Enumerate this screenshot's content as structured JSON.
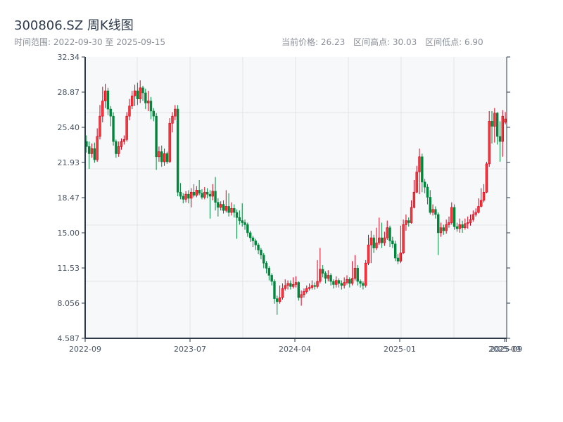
{
  "header": {
    "title": "300806.SZ 周K线图",
    "range_label": "时间范围: 2022-09-30 至 2025-09-15",
    "current_price": "当前价格: 26.23",
    "range_high": "区间高点: 30.03",
    "range_low": "区间低点: 6.90"
  },
  "chart_data": {
    "type": "candlestick",
    "title": "300806.SZ 周K线图",
    "ylim": [
      4.587,
      32.34
    ],
    "y_ticks": [
      "32.34",
      "28.87",
      "25.40",
      "21.93",
      "18.47",
      "15.00",
      "11.53",
      "8.056",
      "4.587"
    ],
    "x_ticks": [
      {
        "label": "2022-09",
        "index": 0
      },
      {
        "label": "2023-07",
        "index": 39
      },
      {
        "label": "2024-04",
        "index": 78
      },
      {
        "label": "2025-01",
        "index": 117
      },
      {
        "label": "2025-09",
        "index": 156
      },
      {
        "label": "2025-09",
        "index": 156.6
      }
    ],
    "grid": true,
    "colors": {
      "up": "#d9001b",
      "down": "#00873c",
      "axis": "#2d3a4a",
      "grid": "#e1e4ea",
      "background": "#f6f8fa"
    },
    "ohlc_fields": [
      "open",
      "high",
      "low",
      "close"
    ],
    "candles": [
      [
        24.0,
        24.6,
        22.9,
        23.5
      ],
      [
        23.5,
        24.0,
        21.3,
        22.8
      ],
      [
        22.8,
        23.8,
        22.4,
        23.3
      ],
      [
        23.3,
        23.9,
        21.9,
        22.2
      ],
      [
        22.2,
        25.3,
        22.0,
        24.5
      ],
      [
        24.5,
        27.6,
        24.2,
        26.5
      ],
      [
        26.5,
        29.4,
        25.9,
        28.0
      ],
      [
        28.0,
        29.7,
        27.3,
        29.0
      ],
      [
        29.0,
        29.3,
        26.6,
        27.2
      ],
      [
        27.2,
        27.5,
        25.5,
        26.5
      ],
      [
        26.5,
        26.9,
        23.6,
        24.0
      ],
      [
        24.0,
        24.2,
        22.4,
        22.8
      ],
      [
        22.8,
        24.0,
        22.5,
        23.5
      ],
      [
        23.5,
        24.3,
        23.2,
        24.0
      ],
      [
        24.0,
        24.6,
        23.7,
        24.2
      ],
      [
        24.2,
        26.9,
        24.0,
        26.5
      ],
      [
        26.5,
        28.2,
        26.1,
        27.5
      ],
      [
        27.5,
        29.0,
        27.2,
        28.5
      ],
      [
        28.5,
        29.6,
        27.5,
        29.0
      ],
      [
        29.0,
        29.8,
        27.6,
        28.2
      ],
      [
        28.2,
        30.03,
        27.8,
        29.3
      ],
      [
        29.3,
        29.5,
        28.0,
        28.8
      ],
      [
        28.8,
        29.2,
        27.2,
        27.8
      ],
      [
        27.8,
        29.0,
        27.0,
        28.0
      ],
      [
        28.0,
        28.4,
        26.2,
        27.0
      ],
      [
        27.0,
        27.3,
        26.0,
        26.5
      ],
      [
        26.5,
        26.8,
        21.2,
        22.5
      ],
      [
        22.5,
        23.5,
        22.0,
        23.0
      ],
      [
        23.0,
        23.6,
        21.5,
        22.0
      ],
      [
        22.0,
        23.3,
        21.6,
        22.8
      ],
      [
        22.8,
        23.0,
        21.8,
        22.0
      ],
      [
        22.0,
        26.3,
        21.9,
        25.8
      ],
      [
        25.8,
        26.9,
        24.9,
        26.5
      ],
      [
        26.5,
        27.6,
        26.1,
        27.2
      ],
      [
        27.2,
        27.6,
        18.6,
        19.0
      ],
      [
        19.0,
        19.9,
        18.3,
        18.6
      ],
      [
        18.6,
        18.9,
        17.9,
        18.3
      ],
      [
        18.3,
        19.1,
        18.0,
        18.8
      ],
      [
        18.8,
        19.2,
        17.9,
        18.4
      ],
      [
        18.4,
        19.4,
        17.5,
        19.0
      ],
      [
        19.0,
        19.8,
        18.5,
        18.7
      ],
      [
        18.7,
        19.6,
        18.5,
        19.2
      ],
      [
        19.2,
        20.2,
        18.7,
        18.9
      ],
      [
        18.9,
        19.3,
        18.3,
        18.5
      ],
      [
        18.5,
        19.5,
        18.3,
        19.0
      ],
      [
        19.0,
        19.4,
        18.4,
        18.8
      ],
      [
        18.8,
        19.2,
        16.4,
        18.6
      ],
      [
        18.6,
        19.8,
        18.2,
        19.1
      ],
      [
        19.1,
        20.5,
        17.2,
        18.0
      ],
      [
        18.0,
        18.4,
        16.6,
        17.5
      ],
      [
        17.5,
        18.1,
        17.2,
        17.8
      ],
      [
        17.8,
        18.2,
        16.9,
        17.2
      ],
      [
        17.2,
        19.2,
        17.0,
        17.6
      ],
      [
        17.6,
        18.9,
        16.6,
        17.0
      ],
      [
        17.0,
        18.0,
        16.7,
        17.4
      ],
      [
        17.4,
        17.8,
        16.5,
        17.0
      ],
      [
        17.0,
        17.3,
        14.4,
        16.5
      ],
      [
        16.5,
        17.2,
        15.8,
        16.2
      ],
      [
        16.2,
        17.9,
        15.6,
        16.0
      ],
      [
        16.0,
        16.3,
        15.3,
        15.8
      ],
      [
        15.8,
        16.0,
        14.6,
        15.0
      ],
      [
        15.0,
        15.2,
        14.1,
        14.5
      ],
      [
        14.5,
        14.7,
        13.6,
        14.2
      ],
      [
        14.2,
        14.4,
        13.3,
        13.8
      ],
      [
        13.8,
        14.0,
        12.9,
        13.3
      ],
      [
        13.3,
        13.5,
        12.4,
        12.8
      ],
      [
        12.8,
        13.0,
        11.5,
        12.0
      ],
      [
        12.0,
        12.2,
        11.0,
        11.5
      ],
      [
        11.5,
        11.7,
        10.3,
        10.8
      ],
      [
        10.8,
        11.0,
        9.8,
        10.2
      ],
      [
        10.2,
        10.4,
        8.0,
        8.5
      ],
      [
        8.5,
        8.8,
        6.9,
        8.2
      ],
      [
        8.2,
        9.8,
        8.0,
        8.6
      ],
      [
        8.6,
        10.0,
        8.4,
        9.5
      ],
      [
        9.5,
        10.4,
        9.3,
        9.8
      ],
      [
        9.8,
        10.3,
        9.4,
        10.0
      ],
      [
        10.0,
        10.3,
        9.4,
        9.7
      ],
      [
        9.7,
        10.6,
        9.5,
        9.9
      ],
      [
        9.9,
        10.7,
        9.6,
        10.1
      ],
      [
        10.1,
        10.2,
        8.3,
        8.6
      ],
      [
        8.6,
        9.3,
        7.8,
        8.9
      ],
      [
        8.9,
        9.5,
        8.6,
        9.2
      ],
      [
        9.2,
        9.8,
        9.0,
        9.5
      ],
      [
        9.5,
        10.0,
        9.3,
        9.6
      ],
      [
        9.6,
        10.3,
        9.4,
        9.8
      ],
      [
        9.8,
        10.1,
        9.4,
        9.7
      ],
      [
        9.7,
        12.3,
        9.5,
        10.2
      ],
      [
        10.2,
        13.5,
        10.0,
        11.4
      ],
      [
        11.4,
        11.8,
        10.6,
        11.0
      ],
      [
        11.0,
        11.2,
        10.0,
        10.5
      ],
      [
        10.5,
        11.3,
        10.2,
        10.8
      ],
      [
        10.8,
        11.0,
        9.8,
        10.2
      ],
      [
        10.2,
        10.4,
        9.5,
        9.9
      ],
      [
        9.9,
        10.7,
        9.6,
        10.3
      ],
      [
        10.3,
        10.5,
        9.6,
        10.0
      ],
      [
        10.0,
        10.3,
        9.4,
        9.8
      ],
      [
        9.8,
        10.6,
        9.5,
        10.1
      ],
      [
        10.1,
        10.8,
        9.9,
        10.4
      ],
      [
        10.4,
        10.6,
        9.6,
        10.0
      ],
      [
        10.0,
        12.2,
        9.8,
        10.5
      ],
      [
        10.5,
        12.8,
        10.3,
        11.5
      ],
      [
        11.5,
        11.8,
        9.8,
        10.2
      ],
      [
        10.2,
        10.4,
        9.6,
        10.0
      ],
      [
        10.0,
        10.2,
        9.4,
        9.8
      ],
      [
        9.8,
        12.3,
        9.6,
        12.0
      ],
      [
        12.0,
        14.8,
        11.8,
        13.8
      ],
      [
        13.8,
        15.2,
        12.0,
        14.5
      ],
      [
        14.5,
        14.8,
        13.0,
        13.5
      ],
      [
        13.5,
        15.5,
        13.3,
        14.0
      ],
      [
        14.0,
        16.5,
        13.8,
        14.5
      ],
      [
        14.5,
        16.0,
        13.5,
        14.0
      ],
      [
        14.0,
        15.1,
        13.7,
        14.5
      ],
      [
        14.5,
        16.2,
        14.3,
        15.5
      ],
      [
        15.5,
        15.7,
        13.6,
        14.2
      ],
      [
        14.2,
        14.6,
        13.5,
        13.9
      ],
      [
        13.9,
        14.2,
        12.2,
        12.5
      ],
      [
        12.5,
        12.9,
        11.9,
        12.2
      ],
      [
        12.2,
        15.7,
        12.0,
        13.0
      ],
      [
        13.0,
        16.3,
        12.9,
        15.8
      ],
      [
        15.8,
        16.8,
        15.2,
        16.2
      ],
      [
        16.2,
        16.5,
        15.6,
        16.0
      ],
      [
        16.0,
        18.2,
        15.9,
        17.5
      ],
      [
        17.5,
        20.2,
        17.4,
        19.0
      ],
      [
        19.0,
        21.6,
        18.9,
        21.0
      ],
      [
        21.0,
        23.3,
        18.8,
        22.5
      ],
      [
        22.5,
        22.8,
        19.0,
        20.0
      ],
      [
        20.0,
        20.3,
        18.9,
        19.5
      ],
      [
        19.5,
        19.8,
        17.8,
        18.5
      ],
      [
        18.5,
        19.2,
        16.8,
        17.0
      ],
      [
        17.0,
        17.8,
        16.7,
        17.3
      ],
      [
        17.3,
        17.6,
        16.4,
        16.8
      ],
      [
        16.8,
        17.0,
        12.8,
        15.0
      ],
      [
        15.0,
        16.0,
        14.6,
        15.5
      ],
      [
        15.5,
        15.8,
        14.8,
        15.2
      ],
      [
        15.2,
        16.3,
        14.9,
        15.8
      ],
      [
        15.8,
        16.6,
        15.5,
        16.0
      ],
      [
        16.0,
        18.0,
        15.8,
        17.5
      ],
      [
        17.5,
        17.8,
        15.3,
        15.6
      ],
      [
        15.6,
        16.0,
        15.1,
        15.4
      ],
      [
        15.4,
        16.4,
        15.0,
        15.8
      ],
      [
        15.8,
        16.2,
        15.0,
        15.5
      ],
      [
        15.5,
        16.4,
        15.3,
        15.9
      ],
      [
        15.9,
        16.6,
        15.4,
        16.0
      ],
      [
        16.0,
        16.8,
        15.7,
        16.3
      ],
      [
        16.3,
        17.2,
        16.1,
        16.8
      ],
      [
        16.8,
        17.4,
        16.6,
        17.0
      ],
      [
        17.0,
        18.4,
        16.9,
        17.6
      ],
      [
        17.6,
        19.4,
        17.5,
        18.2
      ],
      [
        18.2,
        19.8,
        18.0,
        19.0
      ],
      [
        19.0,
        22.0,
        18.9,
        21.8
      ],
      [
        21.8,
        27.0,
        21.5,
        26.0
      ],
      [
        26.0,
        27.0,
        23.8,
        25.5
      ],
      [
        25.5,
        27.3,
        23.9,
        26.8
      ],
      [
        26.8,
        26.9,
        23.7,
        24.5
      ],
      [
        24.5,
        26.0,
        22.0,
        24.0
      ],
      [
        24.0,
        27.1,
        22.5,
        26.5
      ],
      [
        25.9,
        26.9,
        25.7,
        26.23
      ]
    ]
  }
}
